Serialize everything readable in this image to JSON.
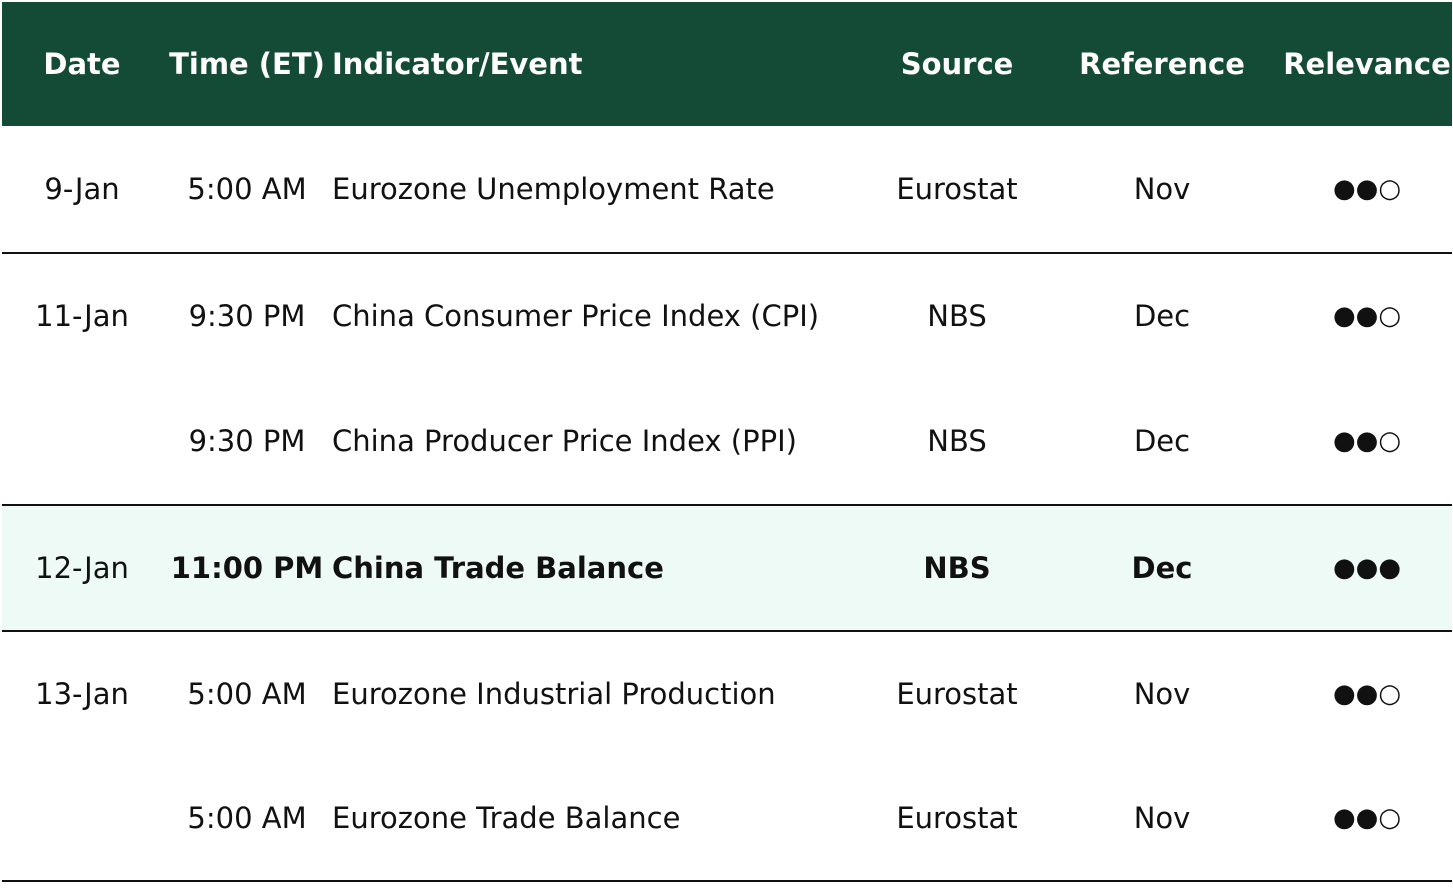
{
  "colors": {
    "header_bg": "#134b37",
    "highlight_bg": "#eefaf6",
    "text": "#111111",
    "header_text": "#ffffff"
  },
  "columns": {
    "date": "Date",
    "time": "Time (ET)",
    "event": "Indicator/Event",
    "source": "Source",
    "reference": "Reference",
    "relevance": "Relevance"
  },
  "rows": [
    {
      "date": "9-Jan",
      "time": "5:00 AM",
      "event": "Eurozone Unemployment Rate",
      "source": "Eurostat",
      "reference": "Nov",
      "relevance": "●●○"
    },
    {
      "date": "11-Jan",
      "time": "9:30 PM",
      "event": "China Consumer Price Index (CPI)",
      "source": "NBS",
      "reference": "Dec",
      "relevance": "●●○"
    },
    {
      "date": "",
      "time": "9:30 PM",
      "event": "China Producer Price Index (PPI)",
      "source": "NBS",
      "reference": "Dec",
      "relevance": "●●○"
    },
    {
      "date": "12-Jan",
      "time": "11:00 PM",
      "event": "China Trade Balance",
      "source": "NBS",
      "reference": "Dec",
      "relevance": "●●●"
    },
    {
      "date": "13-Jan",
      "time": "5:00 AM",
      "event": "Eurozone Industrial Production",
      "source": "Eurostat",
      "reference": "Nov",
      "relevance": "●●○"
    },
    {
      "date": "",
      "time": "5:00 AM",
      "event": "Eurozone Trade Balance",
      "source": "Eurostat",
      "reference": "Nov",
      "relevance": "●●○"
    }
  ]
}
